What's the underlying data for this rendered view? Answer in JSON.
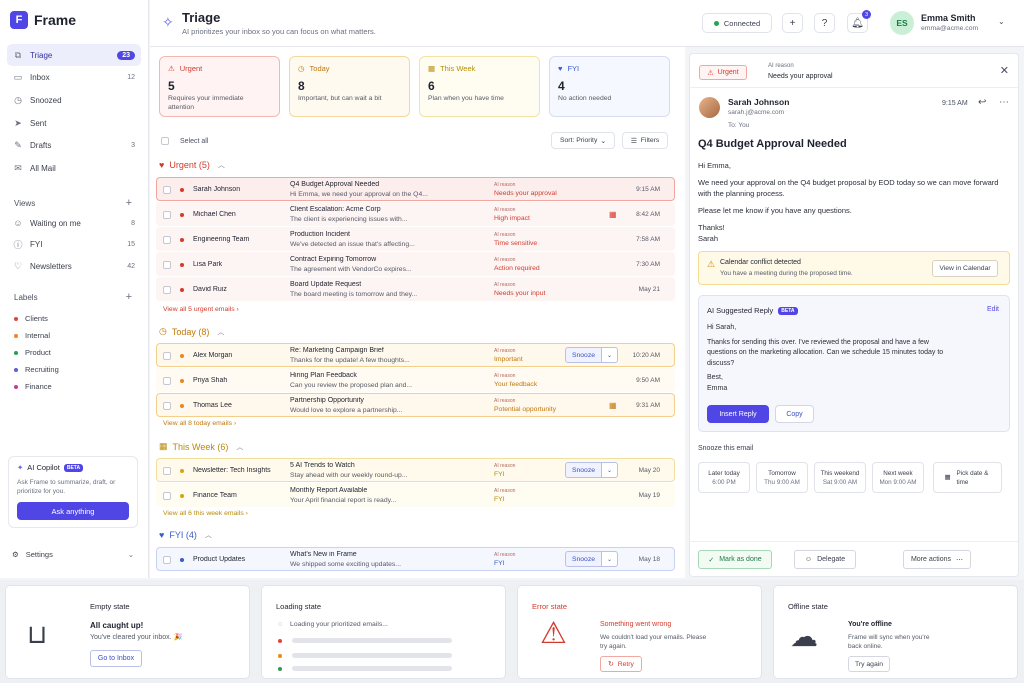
{
  "app": {
    "name": "Frame",
    "logo_letter": "F"
  },
  "colors": {
    "accent": "#4f46e5",
    "urgent": "#d23b2c",
    "today": "#c2780a",
    "this_week": "#b88b0a",
    "fyi": "#3b5bcc",
    "success": "#1e7d44"
  },
  "sidebar": {
    "nav": [
      {
        "label": "Triage",
        "count": "23",
        "icon": "triage-icon",
        "glyph": "⧉"
      },
      {
        "label": "Inbox",
        "count": "12",
        "icon": "inbox-icon",
        "glyph": "▭"
      },
      {
        "label": "Snoozed",
        "count": "",
        "icon": "clock-icon",
        "glyph": "◷"
      },
      {
        "label": "Sent",
        "count": "",
        "icon": "send-icon",
        "glyph": "➤"
      },
      {
        "label": "Drafts",
        "count": "3",
        "icon": "file-icon",
        "glyph": "✎"
      },
      {
        "label": "All Mail",
        "count": "",
        "icon": "mail-icon",
        "glyph": "✉"
      }
    ],
    "views_title": "Views",
    "views": [
      {
        "label": "Waiting on me",
        "count": "8",
        "icon": "user-icon",
        "glyph": "☺"
      },
      {
        "label": "FYI",
        "count": "15",
        "icon": "info-icon",
        "glyph": "ⓘ"
      },
      {
        "label": "Newsletters",
        "count": "42",
        "icon": "heart-icon",
        "glyph": "♡"
      }
    ],
    "labels_title": "Labels",
    "labels": [
      {
        "label": "Clients",
        "color": "#e0453a"
      },
      {
        "label": "Internal",
        "color": "#e8891c"
      },
      {
        "label": "Product",
        "color": "#2e9a55"
      },
      {
        "label": "Recruiting",
        "color": "#5b5fd6"
      },
      {
        "label": "Finance",
        "color": "#c43d8e"
      }
    ],
    "copilot": {
      "title": "AI Copilot",
      "badge": "BETA",
      "desc": "Ask Frame to summarize, draft, or prioritize for you.",
      "button": "Ask anything"
    },
    "settings": "Settings"
  },
  "topbar": {
    "title": "Triage",
    "subtitle": "AI prioritizes your inbox so you can focus on what matters.",
    "connected": "Connected",
    "notif_count": "3",
    "user": {
      "initials": "ES",
      "name": "Emma Smith",
      "email": "emma@acme.com"
    }
  },
  "cards": [
    {
      "label": "Urgent",
      "count": "5",
      "desc": "Requires your immediate attention",
      "glyph": "⚠"
    },
    {
      "label": "Today",
      "count": "8",
      "desc": "Important, but can wait a bit",
      "glyph": "◷"
    },
    {
      "label": "This Week",
      "count": "6",
      "desc": "Plan when you have time",
      "glyph": "▦"
    },
    {
      "label": "FYI",
      "count": "4",
      "desc": "No action needed",
      "glyph": "♥"
    }
  ],
  "toolbar": {
    "select_all": "Select all",
    "sort": "Sort: Priority",
    "filters": "Filters"
  },
  "groups": {
    "urgent": {
      "title": "Urgent (5)",
      "view_all": "View all 5 urgent emails"
    },
    "today": {
      "title": "Today (8)",
      "view_all": "View all 8 today emails"
    },
    "week": {
      "title": "This Week (6)",
      "view_all": "View all 6 this week emails"
    },
    "fyi": {
      "title": "FYI (4)"
    }
  },
  "ai_reason_label": "AI reason",
  "snooze_label": "Snooze",
  "emails": [
    {
      "sender": "Sarah Johnson",
      "subject": "Q4 Budget Approval Needed",
      "preview": "Hi Emma, we need your approval on the Q4...",
      "reason": "Needs your approval",
      "time": "9:15 AM"
    },
    {
      "sender": "Michael Chen",
      "subject": "Client Escalation: Acme Corp",
      "preview": "The client is experiencing issues with...",
      "reason": "High impact",
      "time": "8:42 AM"
    },
    {
      "sender": "Engineering Team",
      "subject": "Production Incident",
      "preview": "We've detected an issue that's affecting...",
      "reason": "Time sensitive",
      "time": "7:58 AM"
    },
    {
      "sender": "Lisa Park",
      "subject": "Contract Expiring Tomorrow",
      "preview": "The agreement with VendorCo expires...",
      "reason": "Action required",
      "time": "7:30 AM"
    },
    {
      "sender": "David Ruiz",
      "subject": "Board Update Request",
      "preview": "The board meeting is tomorrow and they...",
      "reason": "Needs your input",
      "time": "May 21"
    },
    {
      "sender": "Alex Morgan",
      "subject": "Re: Marketing Campaign Brief",
      "preview": "Thanks for the update! A few thoughts...",
      "reason": "Important",
      "time": "10:20 AM"
    },
    {
      "sender": "Priya Shah",
      "subject": "Hiring Plan Feedback",
      "preview": "Can you review the proposed plan and...",
      "reason": "Your feedback",
      "time": "9:50 AM"
    },
    {
      "sender": "Thomas Lee",
      "subject": "Partnership Opportunity",
      "preview": "Would love to explore a partnership...",
      "reason": "Potential opportunity",
      "time": "9:31 AM"
    },
    {
      "sender": "Newsletter: Tech Insights",
      "subject": "5 AI Trends to Watch",
      "preview": "Stay ahead with our weekly round-up...",
      "reason": "FYI",
      "time": "May 20"
    },
    {
      "sender": "Finance Team",
      "subject": "Monthly Report Available",
      "preview": "Your April financial report is ready...",
      "reason": "FYI",
      "time": "May 19"
    },
    {
      "sender": "Product Updates",
      "subject": "What's New in Frame",
      "preview": "We shipped some exciting updates...",
      "reason": "FYI",
      "time": "May 18"
    }
  ],
  "detail": {
    "tag": "Urgent",
    "ai_reason_label": "AI reason",
    "ai_reason": "Needs your approval",
    "sender": "Sarah Johnson",
    "email": "sarah.j@acme.com",
    "to": "To: You",
    "time": "9:15 AM",
    "subject": "Q4 Budget Approval Needed",
    "body": [
      "Hi Emma,",
      "We need your approval on the Q4 budget proposal by EOD today so we can move forward with the planning process.",
      "Please let me know if you have any questions.",
      "Thanks!",
      "Sarah"
    ],
    "conflict": {
      "title": "Calendar conflict detected",
      "subtitle": "You have a meeting during the proposed time.",
      "button": "View in Calendar"
    },
    "suggested": {
      "title": "AI Suggested Reply",
      "badge": "BETA",
      "edit": "Edit",
      "body": [
        "Hi Sarah,",
        "Thanks for sending this over. I've reviewed the proposal and have a few questions on the marketing allocation. Can we schedule 15 minutes today to discuss?",
        "Best,",
        "Emma"
      ],
      "insert": "Insert Reply",
      "copy": "Copy"
    },
    "snooze_title": "Snooze this email",
    "snooze_options": [
      {
        "label": "Later today",
        "sub": "6:00 PM"
      },
      {
        "label": "Tomorrow",
        "sub": "Thu 9:00 AM"
      },
      {
        "label": "This weekend",
        "sub": "Sat 9:00 AM"
      },
      {
        "label": "Next week",
        "sub": "Mon 9:00 AM"
      }
    ],
    "pick": "Pick date & time",
    "mark_done": "Mark as done",
    "delegate": "Delegate",
    "more": "More actions"
  },
  "states": {
    "empty": {
      "label": "Empty state",
      "title": "All caught up!",
      "subtitle": "You've cleared your inbox. 🎉",
      "button": "Go to Inbox"
    },
    "loading": {
      "label": "Loading state",
      "text": "Loading your prioritized emails..."
    },
    "error": {
      "label": "Error state",
      "title": "Something went wrong",
      "subtitle": "We couldn't load your emails. Please try again.",
      "button": "Retry"
    },
    "offline": {
      "label": "Offline state",
      "title": "You're offline",
      "subtitle": "Frame will sync when you're back online.",
      "button": "Try again"
    }
  }
}
